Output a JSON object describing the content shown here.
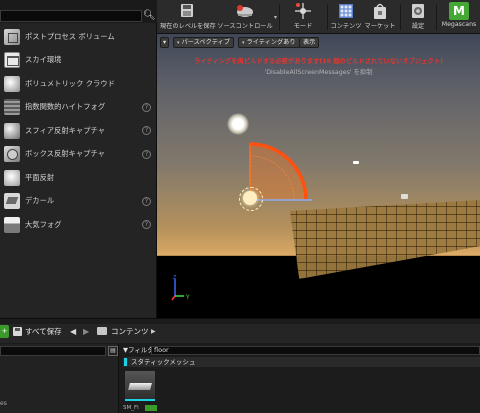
{
  "left_panel": {
    "items": [
      {
        "label": "ポストプロセス ボリューム",
        "icon": "post-process-volume-icon",
        "info": false
      },
      {
        "label": "スカイ環境",
        "icon": "sky-icon",
        "info": false
      },
      {
        "label": "ボリュメトリック クラウド",
        "icon": "volumetric-cloud-icon",
        "info": false
      },
      {
        "label": "指数関数的ハイトフォグ",
        "icon": "height-fog-icon",
        "info": true
      },
      {
        "label": "スフィア反射キャプチャ",
        "icon": "sphere-reflection-icon",
        "info": true
      },
      {
        "label": "ボックス反射キャプチャ",
        "icon": "box-reflection-icon",
        "info": true
      },
      {
        "label": "平面反射",
        "icon": "planar-reflection-icon",
        "info": false
      },
      {
        "label": "デカール",
        "icon": "decal-icon",
        "info": true
      },
      {
        "label": "大気フォグ",
        "icon": "atmospheric-fog-icon",
        "info": true
      }
    ],
    "info_glyph": "?"
  },
  "toolbar": {
    "save": "現在のレベルを保存",
    "source_control": "ソースコントロール",
    "modes": "モード",
    "content": "コンテンツ",
    "market": "マーケット",
    "settings": "設定",
    "megascans": "Megascans",
    "megascans_icon_letter": "M"
  },
  "viewport": {
    "perspective": "パースペクティブ",
    "lighting": "ライティングあり",
    "show": "表示",
    "warning": "ライティングを再ビルドする必要があります(16 個のビルドされていないオブジェクト)",
    "disable_msg": "'DisableAllScreenMessages' を抑制"
  },
  "content_browser": {
    "save_all": "すべて保存",
    "path": "コンテンツ",
    "filter": "フィルタ",
    "filter_value": "floor",
    "category": "スタティックメッシュ",
    "asset_name": "SM_Fl",
    "left_item": "es",
    "green_glyph": "+"
  },
  "colors": {
    "accent_cyan": "#19d3e5",
    "save_green": "#3b9a2b",
    "warning_red": "#e2362f",
    "megascans_green": "#46a834"
  }
}
